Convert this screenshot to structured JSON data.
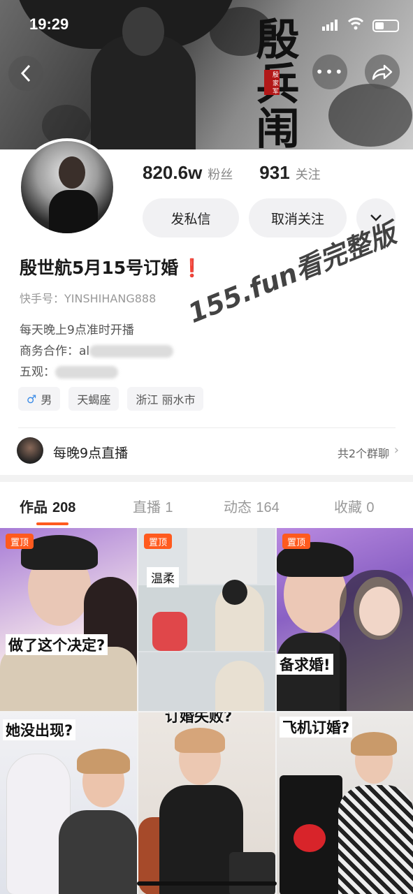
{
  "status_bar": {
    "time": "19:29"
  },
  "cover": {
    "calligraphy": "殷 兵 闱",
    "seal_text": "殷 家 军"
  },
  "header": {
    "back_icon": "back-arrow-icon",
    "more_icon": "more-dots-icon",
    "share_icon": "share-icon"
  },
  "stats": {
    "followers_value": "820.6w",
    "followers_label": "粉丝",
    "following_value": "931",
    "following_label": "关注"
  },
  "actions": {
    "message_label": "发私信",
    "unfollow_label": "取消关注",
    "dropdown_icon": "chevron-down-icon"
  },
  "profile": {
    "nickname": "殷世航5月15号订婚",
    "nickname_mark": "❗",
    "kuaishou_id": "快手号：YINSHIHANG888",
    "bio_line1": "每天晚上9点准时开播",
    "bio_line2_prefix": "商务合作：al",
    "bio_line3_prefix": "五观：",
    "tags": {
      "gender_symbol": "♂",
      "gender": "男",
      "zodiac": "天蝎座",
      "location": "浙江 丽水市"
    }
  },
  "watermark": "155.fun看完整版",
  "live_row": {
    "title": "每晚9点直播",
    "groups": "共2个群聊",
    "chevron": "›"
  },
  "tabs": [
    {
      "label": "作品",
      "count": "208"
    },
    {
      "label": "直播",
      "count": "1"
    },
    {
      "label": "动态",
      "count": "164"
    },
    {
      "label": "收藏",
      "count": "0"
    }
  ],
  "grid": {
    "pinned_label": "置顶",
    "captions": [
      "做了这个决定?",
      "温柔",
      "备求婚!",
      "她没出现?",
      "订婚失败?",
      "飞机订婚?"
    ]
  },
  "colors": {
    "accent": "#ff5a1e",
    "male_blue": "#3a8be6",
    "alert_red": "#e12d2d"
  }
}
